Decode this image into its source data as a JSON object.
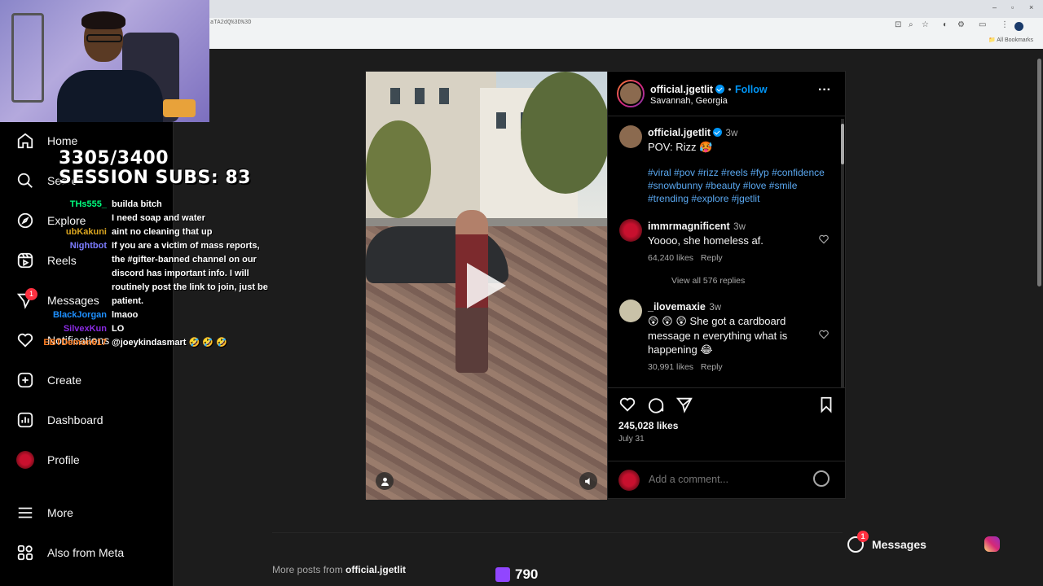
{
  "browser": {
    "url": "aTA2dQ%3D%3D",
    "bookmarks_label": "All Bookmarks"
  },
  "sidebar": {
    "items": [
      {
        "label": "Home",
        "icon": "home-icon"
      },
      {
        "label": "Search",
        "icon": "search-icon"
      },
      {
        "label": "Explore",
        "icon": "compass-icon"
      },
      {
        "label": "Reels",
        "icon": "reels-icon"
      },
      {
        "label": "Messages",
        "icon": "messenger-icon",
        "badge": "1"
      },
      {
        "label": "Notifications",
        "icon": "heart-icon"
      },
      {
        "label": "Create",
        "icon": "plus-square-icon"
      },
      {
        "label": "Dashboard",
        "icon": "dashboard-icon"
      },
      {
        "label": "Profile",
        "icon": "profile-avatar"
      },
      {
        "label": "More",
        "icon": "menu-icon"
      },
      {
        "label": "Also from Meta",
        "icon": "meta-grid-icon"
      }
    ]
  },
  "stream": {
    "sub_count": "3305/3400",
    "session_subs": "SESSION SUBS: 83",
    "chat": [
      {
        "user": "THs555_",
        "color": "#00ff7f",
        "text": "builda bitch"
      },
      {
        "user": "",
        "color": "#1e90ff",
        "text": "I need soap and water"
      },
      {
        "user": "ubKakuni",
        "color": "#daa520",
        "text": "aint no cleaning that up"
      },
      {
        "user": "Nightbot",
        "color": "#7c7cff",
        "text": "If you are a victim of mass reports, the #gifter-banned channel on our discord has important info. I will routinely post the link to join, just be patient."
      },
      {
        "user": "BlackJorgan",
        "color": "#1e90ff",
        "text": "lmaoo"
      },
      {
        "user": "SilvexKun",
        "color": "#8a2be2",
        "text": "LO"
      },
      {
        "user": "EBTDemon617",
        "color": "#ff7f24",
        "text": "@joeykindasmart 🤣 🤣 🤣"
      }
    ]
  },
  "post": {
    "author": "official.jgetlit",
    "follow_label": "Follow",
    "location": "Savannah, Georgia",
    "caption_time": "3w",
    "caption": "POV: Rizz 🥵",
    "hashtags": "#viral #pov #rizz #reels #fyp #confidence #snowbunny #beauty #love #smile #trending #explore #jgetlit",
    "comments": [
      {
        "user": "immrmagnificent",
        "time": "3w",
        "text": "Yoooo, she homeless af.",
        "likes": "64,240 likes",
        "reply": "Reply",
        "view_replies": "View all 576 replies"
      },
      {
        "user": "_ilovemaxie",
        "time": "3w",
        "text": "😲 😲 😲 She got a cardboard message n everything what is happening 😂",
        "likes": "30,991 likes",
        "reply": "Reply"
      }
    ],
    "likes": "245,028 likes",
    "date": "July 31",
    "comment_placeholder": "Add a comment..."
  },
  "footer": {
    "more_posts_prefix": "More posts from ",
    "more_posts_user": "official.jgetlit",
    "bits": "790"
  },
  "messages_bar": {
    "label": "Messages",
    "badge": "1"
  }
}
